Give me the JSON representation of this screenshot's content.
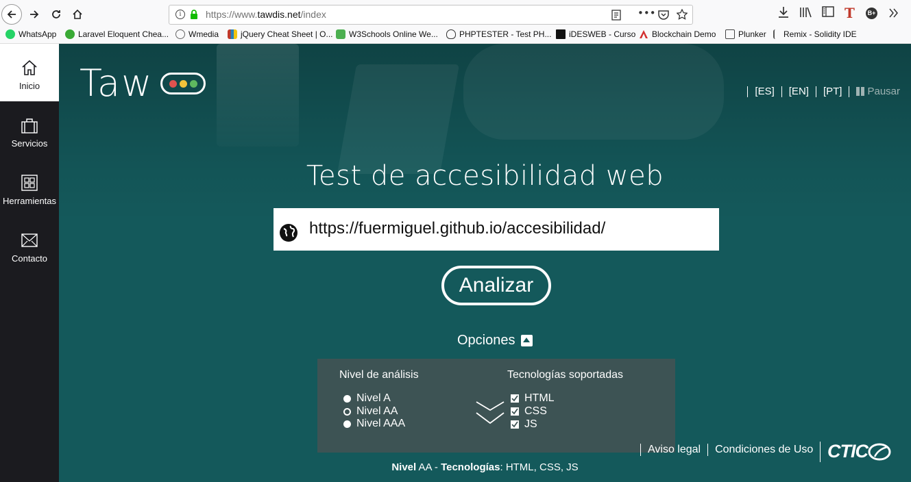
{
  "browser": {
    "url_prefix": "https://www.",
    "url_domain": "tawdis.net",
    "url_path": "/index",
    "bookmarks": [
      {
        "label": "WhatsApp",
        "color": "#25d366"
      },
      {
        "label": "Laravel Eloquent Chea...",
        "color": "#3aaa35"
      },
      {
        "label": "Wmedia",
        "color": "#666666"
      },
      {
        "label": "jQuery Cheat Sheet | O...",
        "color": "#c0392b"
      },
      {
        "label": "W3Schools Online We...",
        "color": "#4caf50"
      },
      {
        "label": "PHPTESTER - Test PH...",
        "color": "#333333"
      },
      {
        "label": "iDESWEB - Curso",
        "color": "#111111"
      },
      {
        "label": "Blockchain Demo",
        "color": "#d32f2f"
      },
      {
        "label": "Plunker",
        "color": "#444444"
      },
      {
        "label": "Remix - Solidity IDE",
        "color": "#555555"
      }
    ]
  },
  "sidebar": {
    "items": [
      {
        "label": "Inicio",
        "icon": "home-icon",
        "active": true
      },
      {
        "label": "Servicios",
        "icon": "briefcase-icon",
        "active": false
      },
      {
        "label": "Herramientas",
        "icon": "grid-icon",
        "active": false
      },
      {
        "label": "Contacto",
        "icon": "envelope-icon",
        "active": false
      }
    ]
  },
  "header": {
    "logo_text": "Taw",
    "logo_dot_colors": [
      "#e0524f",
      "#f2c23a",
      "#5fb85f"
    ],
    "languages": [
      "[ES]",
      "[EN]",
      "[PT]"
    ],
    "pause_label": "Pausar"
  },
  "main": {
    "title": "Test de accesibilidad web",
    "url_input_value": "https://fuermiguel.github.io/accesibilidad/",
    "analyze_button": "Analizar",
    "options_label": "Opciones"
  },
  "options": {
    "level_title": "Nivel de análisis",
    "levels": [
      {
        "label": "Nivel A",
        "selected": false
      },
      {
        "label": "Nivel AA",
        "selected": true
      },
      {
        "label": "Nivel AAA",
        "selected": false
      }
    ],
    "tech_title": "Tecnologías soportadas",
    "technologies": [
      {
        "label": "HTML",
        "checked": true
      },
      {
        "label": "CSS",
        "checked": true
      },
      {
        "label": "JS",
        "checked": true
      }
    ]
  },
  "footer": {
    "legal_link": "Aviso legal",
    "terms_link": "Condiciones de Uso",
    "brand": "CTIC"
  },
  "status": {
    "level_label": "Nivel",
    "level_value": "AA",
    "tech_label": "Tecnologías",
    "tech_value": "HTML, CSS, JS"
  },
  "colors": {
    "main_bg": "#14595b",
    "sidebar_bg": "#1b1b1f",
    "panel_bg": "#3d5354"
  }
}
